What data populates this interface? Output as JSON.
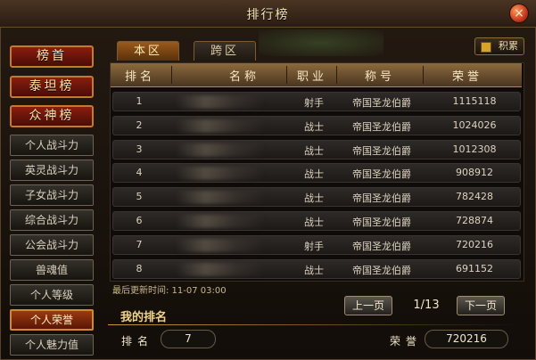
{
  "window": {
    "title": "排行榜",
    "close_label": "×"
  },
  "left_menu": {
    "major": [
      "榜首",
      "泰坦榜",
      "众神榜"
    ],
    "minor": [
      "个人战斗力",
      "英灵战斗力",
      "子女战斗力",
      "综合战斗力",
      "公会战斗力",
      "兽魂值",
      "个人等级",
      "个人荣誉",
      "个人魅力值"
    ],
    "active": "个人荣誉"
  },
  "tabs": [
    "本区",
    "跨区"
  ],
  "active_tab": "本区",
  "jifen_label": "积累",
  "table": {
    "headers": [
      "排名",
      "名称",
      "职业",
      "称号",
      "荣誉"
    ],
    "rows": [
      {
        "rank": "1",
        "name": "",
        "job": "射手",
        "title": "帝国圣龙伯爵",
        "honor": "1115118"
      },
      {
        "rank": "2",
        "name": "",
        "job": "战士",
        "title": "帝国圣龙伯爵",
        "honor": "1024026"
      },
      {
        "rank": "3",
        "name": "",
        "job": "战士",
        "title": "帝国圣龙伯爵",
        "honor": "1012308"
      },
      {
        "rank": "4",
        "name": "",
        "job": "战士",
        "title": "帝国圣龙伯爵",
        "honor": "908912"
      },
      {
        "rank": "5",
        "name": "",
        "job": "战士",
        "title": "帝国圣龙伯爵",
        "honor": "782428"
      },
      {
        "rank": "6",
        "name": "",
        "job": "战士",
        "title": "帝国圣龙伯爵",
        "honor": "728874"
      },
      {
        "rank": "7",
        "name": "",
        "job": "射手",
        "title": "帝国圣龙伯爵",
        "honor": "720216"
      },
      {
        "rank": "8",
        "name": "",
        "job": "战士",
        "title": "帝国圣龙伯爵",
        "honor": "691152"
      }
    ]
  },
  "last_updated": "最后更新时间: 11-07 03:00",
  "pagination": {
    "prev": "上一页",
    "page": "1/13",
    "next": "下一页"
  },
  "my_rank": {
    "heading": "我的排名",
    "rank_label": "排名",
    "rank_value": "7",
    "honor_label": "荣誉",
    "honor_value": "720216"
  }
}
